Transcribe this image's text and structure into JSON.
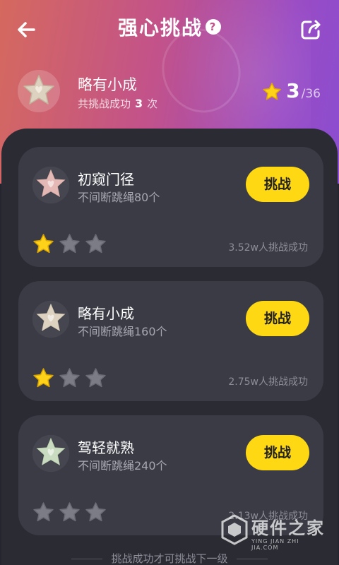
{
  "header": {
    "title": "强心挑战",
    "help_icon": "?",
    "back_icon": "back-arrow-icon",
    "share_icon": "share-icon"
  },
  "rank": {
    "name": "略有小成",
    "sub_prefix": "共挑战成功",
    "sub_count": "3",
    "sub_suffix": "次",
    "stars_earned": "3",
    "stars_total": "/36"
  },
  "challenges": [
    {
      "name": "初窥门径",
      "desc": "不间断跳绳80个",
      "button": "挑战",
      "success": "3.52w人挑战成功",
      "stars": 1,
      "badge_color": "#e4b8b5"
    },
    {
      "name": "略有小成",
      "desc": "不间断跳绳160个",
      "button": "挑战",
      "success": "2.75w人挑战成功",
      "stars": 1,
      "badge_color": "#ddd2bf"
    },
    {
      "name": "驾轻就熟",
      "desc": "不间断跳绳240个",
      "button": "挑战",
      "success": "2.13w人挑战成功",
      "stars": 0,
      "badge_color": "#c9dcc0"
    }
  ],
  "footer": {
    "hint": "挑战成功才可挑战下一级"
  },
  "watermark": {
    "title": "硬件之家",
    "sub": "YING JIAN ZHI JIA.COM"
  },
  "colors": {
    "accent": "#ffd814",
    "star_on": "#ffd21a",
    "star_off": "#7b7c85",
    "panel": "#2a2b33",
    "card": "#3a3b45"
  }
}
